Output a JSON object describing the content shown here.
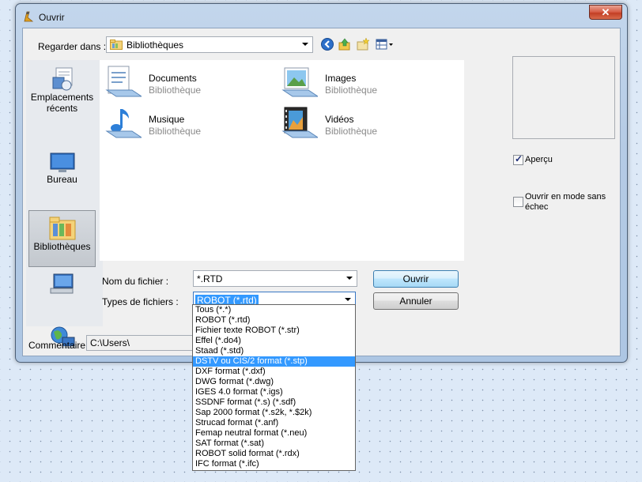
{
  "window": {
    "title": "Ouvrir",
    "close_symbol": "✕"
  },
  "toolbar": {
    "look_in_label": "Regarder dans :",
    "look_in_value": "Bibliothèques"
  },
  "places": [
    {
      "label": "Emplacements récents",
      "icon": "recent-places-icon"
    },
    {
      "label": "Bureau",
      "icon": "desktop-icon"
    },
    {
      "label": "Bibliothèques",
      "icon": "libraries-icon",
      "selected": true
    },
    {
      "label": "",
      "icon": "computer-icon"
    },
    {
      "label": "",
      "icon": "network-icon"
    }
  ],
  "libraries": [
    {
      "name": "Documents",
      "type": "Bibliothèque",
      "icon": "documents-library-icon"
    },
    {
      "name": "Images",
      "type": "Bibliothèque",
      "icon": "images-library-icon"
    },
    {
      "name": "Musique",
      "type": "Bibliothèque",
      "icon": "music-library-icon"
    },
    {
      "name": "Vidéos",
      "type": "Bibliothèque",
      "icon": "videos-library-icon"
    }
  ],
  "preview": {
    "apercu_label": "Aperçu",
    "apercu_checked": true,
    "safe_mode_label": "Ouvrir en mode sans échec",
    "safe_mode_checked": false
  },
  "filename": {
    "label": "Nom du fichier :",
    "value": "*.RTD"
  },
  "filetypes": {
    "label": "Types de fichiers :",
    "value": "ROBOT (*.rtd)",
    "options": [
      "Tous (*.*)",
      "ROBOT (*.rtd)",
      "Fichier texte ROBOT (*.str)",
      "Effel (*.do4)",
      "Staad (*.std)",
      "DSTV ou CIS/2 format (*.stp)",
      "DXF format (*.dxf)",
      "DWG format (*.dwg)",
      "IGES 4.0 format (*.igs)",
      "SSDNF format (*.s) (*.sdf)",
      "Sap 2000 format (*.s2k, *.$2k)",
      "Strucad format (*.anf)",
      "Femap neutral format (*.neu)",
      "SAT format (*.sat)",
      "ROBOT solid format (*.rdx)",
      "IFC format (*.ifc)"
    ],
    "highlighted_index": 5
  },
  "buttons": {
    "open": "Ouvrir",
    "cancel": "Annuler"
  },
  "comment": {
    "label": "Commentaire:",
    "value": "C:\\Users\\"
  }
}
